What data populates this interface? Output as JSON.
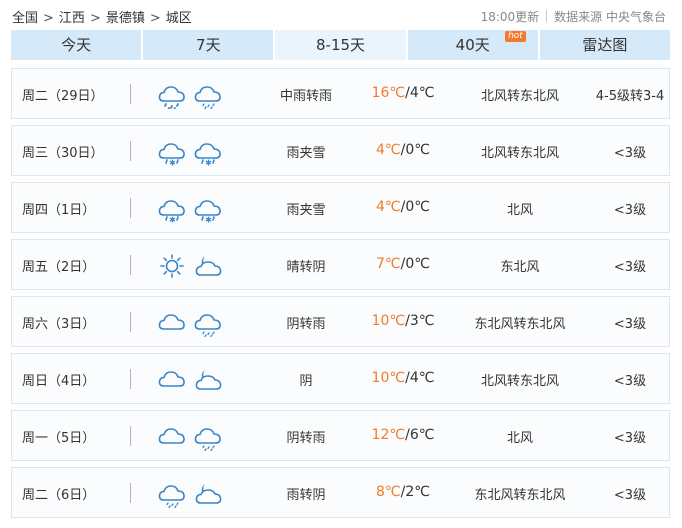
{
  "breadcrumb": [
    "全国",
    "江西",
    "景德镇",
    "城区"
  ],
  "breadcrumb_sep": ">",
  "update_time": "18:00更新",
  "source": "数据来源 中央气象台",
  "tabs": [
    {
      "label": "今天",
      "active": false
    },
    {
      "label": "7天",
      "active": false
    },
    {
      "label": "8-15天",
      "active": true
    },
    {
      "label": "40天",
      "active": false,
      "badge": "hot"
    },
    {
      "label": "雷达图",
      "active": false
    }
  ],
  "colors": {
    "accent": "#f27a2a",
    "tab_bg": "#d6e9f9",
    "tab_active_bg": "#eaf4fc",
    "icon_stroke": "#3a86c8"
  },
  "forecast": [
    {
      "day": "周二（29日）",
      "icons": [
        "cloud-rain-icon",
        "cloud-light-rain-icon"
      ],
      "weather": "中雨转雨",
      "high": "16℃",
      "low": "4℃",
      "wind": "北风转东北风",
      "level": "4-5级转3-4"
    },
    {
      "day": "周三（30日）",
      "icons": [
        "cloud-sleet-icon",
        "cloud-sleet-icon"
      ],
      "weather": "雨夹雪",
      "high": "4℃",
      "low": "0℃",
      "wind": "北风转东北风",
      "level": "<3级"
    },
    {
      "day": "周四（1日）",
      "icons": [
        "cloud-sleet-icon",
        "cloud-sleet-icon"
      ],
      "weather": "雨夹雪",
      "high": "4℃",
      "low": "0℃",
      "wind": "北风",
      "level": "<3级"
    },
    {
      "day": "周五（2日）",
      "icons": [
        "sun-icon",
        "cloud-moon-icon"
      ],
      "weather": "晴转阴",
      "high": "7℃",
      "low": "0℃",
      "wind": "东北风",
      "level": "<3级"
    },
    {
      "day": "周六（3日）",
      "icons": [
        "cloud-icon",
        "cloud-light-rain-icon"
      ],
      "weather": "阴转雨",
      "high": "10℃",
      "low": "3℃",
      "wind": "东北风转东北风",
      "level": "<3级"
    },
    {
      "day": "周日（4日）",
      "icons": [
        "cloud-icon",
        "cloud-moon-icon"
      ],
      "weather": "阴",
      "high": "10℃",
      "low": "4℃",
      "wind": "北风转东北风",
      "level": "<3级"
    },
    {
      "day": "周一（5日）",
      "icons": [
        "cloud-icon",
        "cloud-light-rain-icon"
      ],
      "weather": "阴转雨",
      "high": "12℃",
      "low": "6℃",
      "wind": "北风",
      "level": "<3级"
    },
    {
      "day": "周二（6日）",
      "icons": [
        "cloud-light-rain-icon",
        "cloud-moon-icon"
      ],
      "weather": "雨转阴",
      "high": "8℃",
      "low": "2℃",
      "wind": "东北风转东北风",
      "level": "<3级"
    }
  ]
}
